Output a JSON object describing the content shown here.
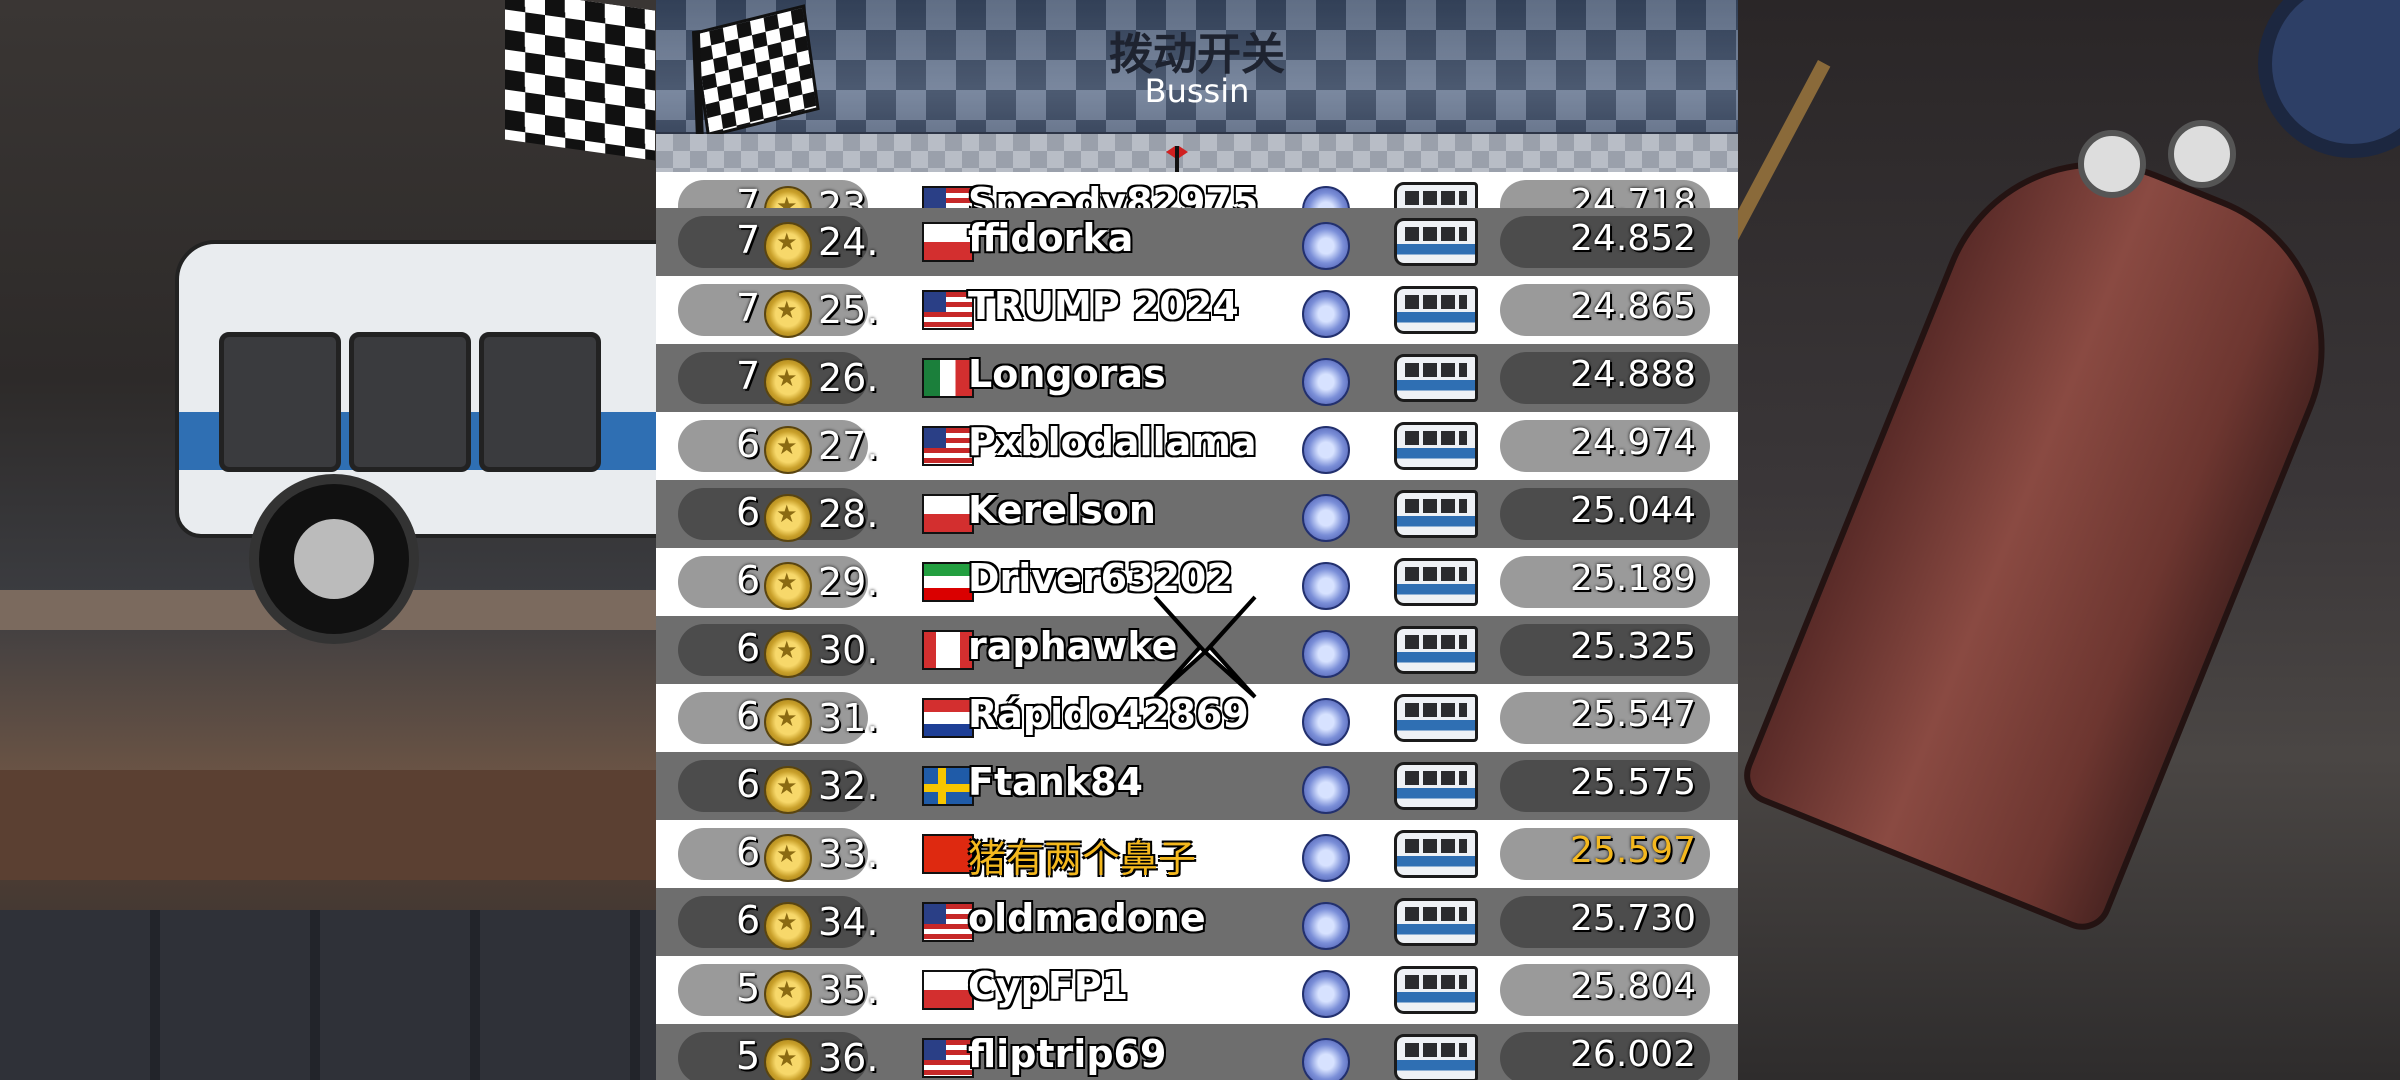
{
  "header": {
    "title": "拨动开关",
    "subtitle": "Bussin"
  },
  "leaderboard": {
    "rows": [
      {
        "level": "7",
        "rank": "23.",
        "flag": "US",
        "name": "Speedy82975",
        "time": "24.718",
        "partial": true
      },
      {
        "level": "7",
        "rank": "24.",
        "flag": "CZ",
        "name": "ffidorka",
        "time": "24.852"
      },
      {
        "level": "7",
        "rank": "25.",
        "flag": "US",
        "name": "TRUMP 2024",
        "time": "24.865"
      },
      {
        "level": "7",
        "rank": "26.",
        "flag": "MX",
        "name": "Longoras",
        "time": "24.888"
      },
      {
        "level": "6",
        "rank": "27.",
        "flag": "US",
        "name": "Pxblodallama",
        "time": "24.974"
      },
      {
        "level": "6",
        "rank": "28.",
        "flag": "PL",
        "name": "Kerelson",
        "time": "25.044"
      },
      {
        "level": "6",
        "rank": "29.",
        "flag": "IR",
        "name": "Driver63202",
        "time": "25.189"
      },
      {
        "level": "6",
        "rank": "30.",
        "flag": "CA",
        "name": "raphawke",
        "time": "25.325"
      },
      {
        "level": "6",
        "rank": "31.",
        "flag": "PY",
        "name": "Rápido42869",
        "time": "25.547"
      },
      {
        "level": "6",
        "rank": "32.",
        "flag": "SE",
        "name": "Ftank84",
        "time": "25.575"
      },
      {
        "level": "6",
        "rank": "33.",
        "flag": "CN",
        "name": "猪有两个鼻子",
        "time": "25.597",
        "me": true
      },
      {
        "level": "6",
        "rank": "34.",
        "flag": "US",
        "name": "oldmadone",
        "time": "25.730"
      },
      {
        "level": "5",
        "rank": "35.",
        "flag": "PL",
        "name": "CypFP1",
        "time": "25.804"
      },
      {
        "level": "5",
        "rank": "36.",
        "flag": "US",
        "name": "fliptrip69",
        "time": "26.002"
      }
    ]
  },
  "icons": {
    "header_flag": "checkered-flag-icon",
    "subbar": "pin-flag-icon",
    "medal": "medal-icon",
    "badge": "rank-badge-icon",
    "vehicle": "bus-vehicle-icon"
  },
  "colors": {
    "highlight": "#f4b81e",
    "row_light": "#ffffff",
    "row_dark": "#6e6e6e"
  }
}
